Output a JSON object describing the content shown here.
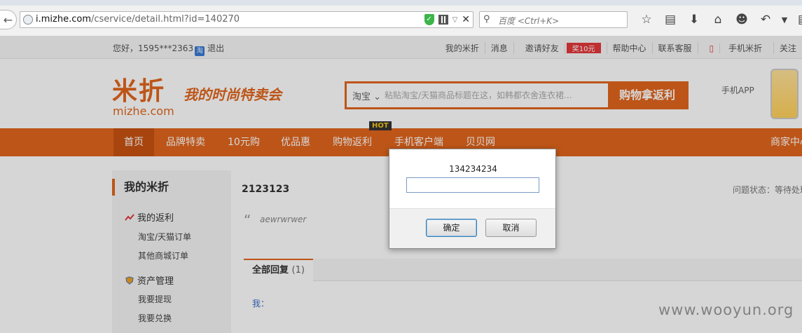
{
  "browser": {
    "url_domain": "i.mizhe.com",
    "url_path": "/cservice/detail.html?id=140270",
    "search_placeholder": "百度 <Ctrl+K>",
    "back_icon": "back-arrow-icon",
    "toolbar_icons": [
      "star-icon",
      "reading-list-icon",
      "download-icon",
      "home-icon",
      "chat-icon",
      "undo-icon",
      "dropdown-icon",
      "tab-icon"
    ]
  },
  "topbar": {
    "greeting": "您好，1595***2363",
    "logout": "退出",
    "links": [
      "我的米折",
      "消息",
      "邀请好友",
      "帮助中心",
      "联系客服",
      "手机米折",
      "关注"
    ],
    "invite_badge": "奖10元"
  },
  "header": {
    "logo_cn": "米折",
    "logo_en": "mizhe.com",
    "slogan": "我的时尚特卖会",
    "search_type": "淘宝",
    "search_placeholder": "粘贴淘宝/天猫商品标题在这，如韩都衣舍连衣裙...",
    "search_button": "购物拿返利",
    "app_label": "手机APP"
  },
  "nav": {
    "items": [
      "首页",
      "品牌特卖",
      "10元购",
      "优品惠",
      "购物返利",
      "手机客户端",
      "贝贝网"
    ],
    "right_item": "商家中心",
    "hot_tag": "HOT",
    "accent": "#e2661d"
  },
  "sidebar": {
    "title": "我的米折",
    "section1": "我的返利",
    "section1_items": [
      "淘宝/天猫订单",
      "其他商城订单"
    ],
    "section2": "资产管理",
    "section2_items": [
      "我要提现",
      "我要兑换"
    ]
  },
  "main": {
    "title": "2123123",
    "status": "问题状态：等待处理",
    "quote": "aewrwrwer",
    "replies_tab": "全部回复",
    "replies_count": "(1)",
    "me_label": "我："
  },
  "dialog": {
    "message": "134234234",
    "input_value": "",
    "ok_label": "确定",
    "cancel_label": "取消"
  },
  "watermark": "www.wooyun.org"
}
